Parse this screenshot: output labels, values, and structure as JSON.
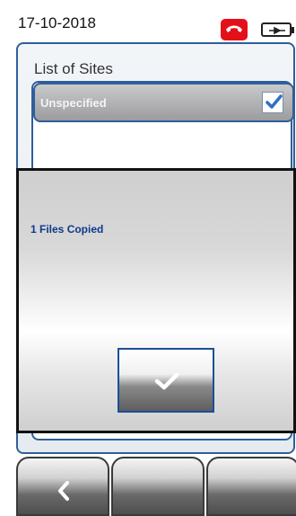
{
  "status": {
    "date": "17-10-2018",
    "call_icon": "phone-hangup-icon",
    "battery_icon": "battery-charging-icon"
  },
  "panel": {
    "title": "List of Sites",
    "sites": [
      {
        "label": "Unspecified",
        "checked": true
      }
    ]
  },
  "dialog": {
    "message": "1 Files Copied",
    "ok_icon": "checkmark-icon"
  },
  "softkeys": [
    {
      "icon": "chevron-left-icon"
    },
    {
      "icon": ""
    },
    {
      "icon": ""
    }
  ],
  "colors": {
    "accent_blue": "#2f5f9a",
    "message_blue": "#0d3a8a",
    "call_red": "#e3101a"
  }
}
